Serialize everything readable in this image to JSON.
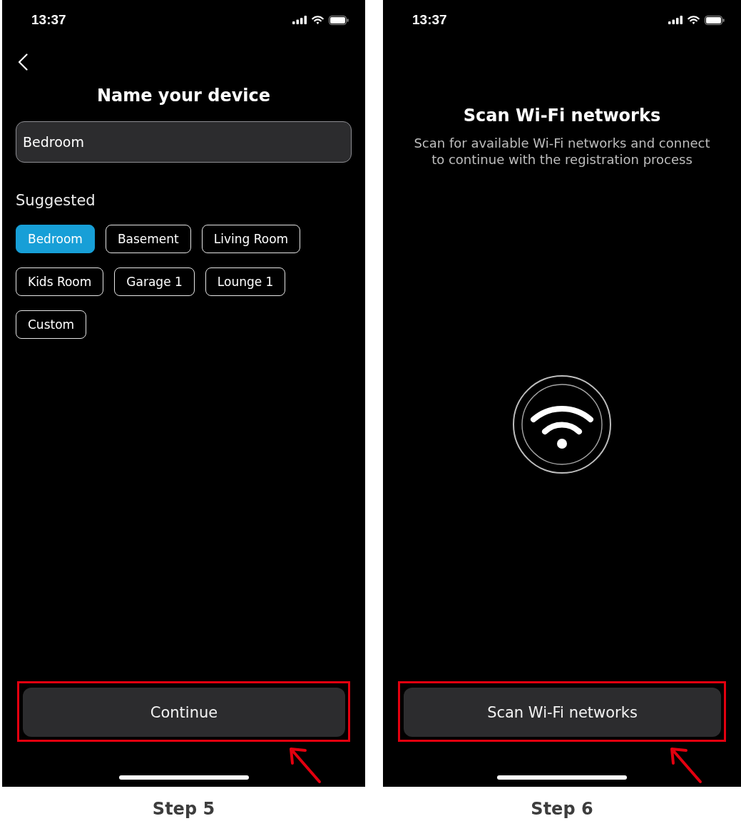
{
  "screens": [
    {
      "kind": "name-device",
      "status_bar": {
        "time": "13:37"
      },
      "title": "Name your device",
      "name_field": {
        "value": "Bedroom"
      },
      "suggested_label": "Suggested",
      "suggestions": [
        {
          "label": "Bedroom",
          "selected": true
        },
        {
          "label": "Basement",
          "selected": false
        },
        {
          "label": "Living Room",
          "selected": false
        },
        {
          "label": "Kids Room",
          "selected": false
        },
        {
          "label": "Garage 1",
          "selected": false
        },
        {
          "label": "Lounge 1",
          "selected": false
        },
        {
          "label": "Custom",
          "selected": false
        }
      ],
      "primary_button": {
        "label": "Continue",
        "highlighted": true
      },
      "caption": "Step 5"
    },
    {
      "kind": "scan-wifi",
      "status_bar": {
        "time": "13:37"
      },
      "title": "Scan Wi-Fi networks",
      "subtitle": "Scan for available Wi-Fi networks and connect to continue with the registration process",
      "primary_button": {
        "label": "Scan Wi-Fi networks",
        "highlighted": true
      },
      "caption": "Step 6"
    }
  ]
}
